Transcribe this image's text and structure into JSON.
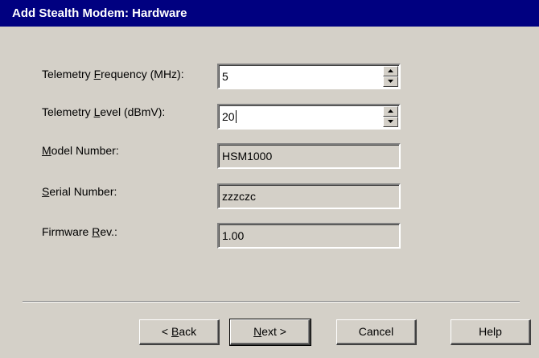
{
  "window": {
    "title": "Add Stealth Modem: Hardware"
  },
  "fields": {
    "telemetry_frequency": {
      "label_pre": "Telemetry ",
      "label_accel": "F",
      "label_post": "requency (MHz):",
      "value": "5"
    },
    "telemetry_level": {
      "label_pre": "Telemetry ",
      "label_accel": "L",
      "label_post": "evel (dBmV):",
      "value": "20"
    },
    "model_number": {
      "label_pre": "",
      "label_accel": "M",
      "label_post": "odel Number:",
      "value": "HSM1000"
    },
    "serial_number": {
      "label_pre": "",
      "label_accel": "S",
      "label_post": "erial Number:",
      "value": "zzzczc"
    },
    "firmware_rev": {
      "label_pre": "Firmware ",
      "label_accel": "R",
      "label_post": "ev.:",
      "value": "1.00"
    }
  },
  "buttons": {
    "back": {
      "pre": "< ",
      "accel": "B",
      "post": "ack"
    },
    "next": {
      "pre": "",
      "accel": "N",
      "post": "ext >"
    },
    "cancel": {
      "label": "Cancel"
    },
    "help": {
      "label": "Help"
    }
  },
  "icons": {
    "spin_up": "up-arrow-icon",
    "spin_down": "down-arrow-icon"
  }
}
